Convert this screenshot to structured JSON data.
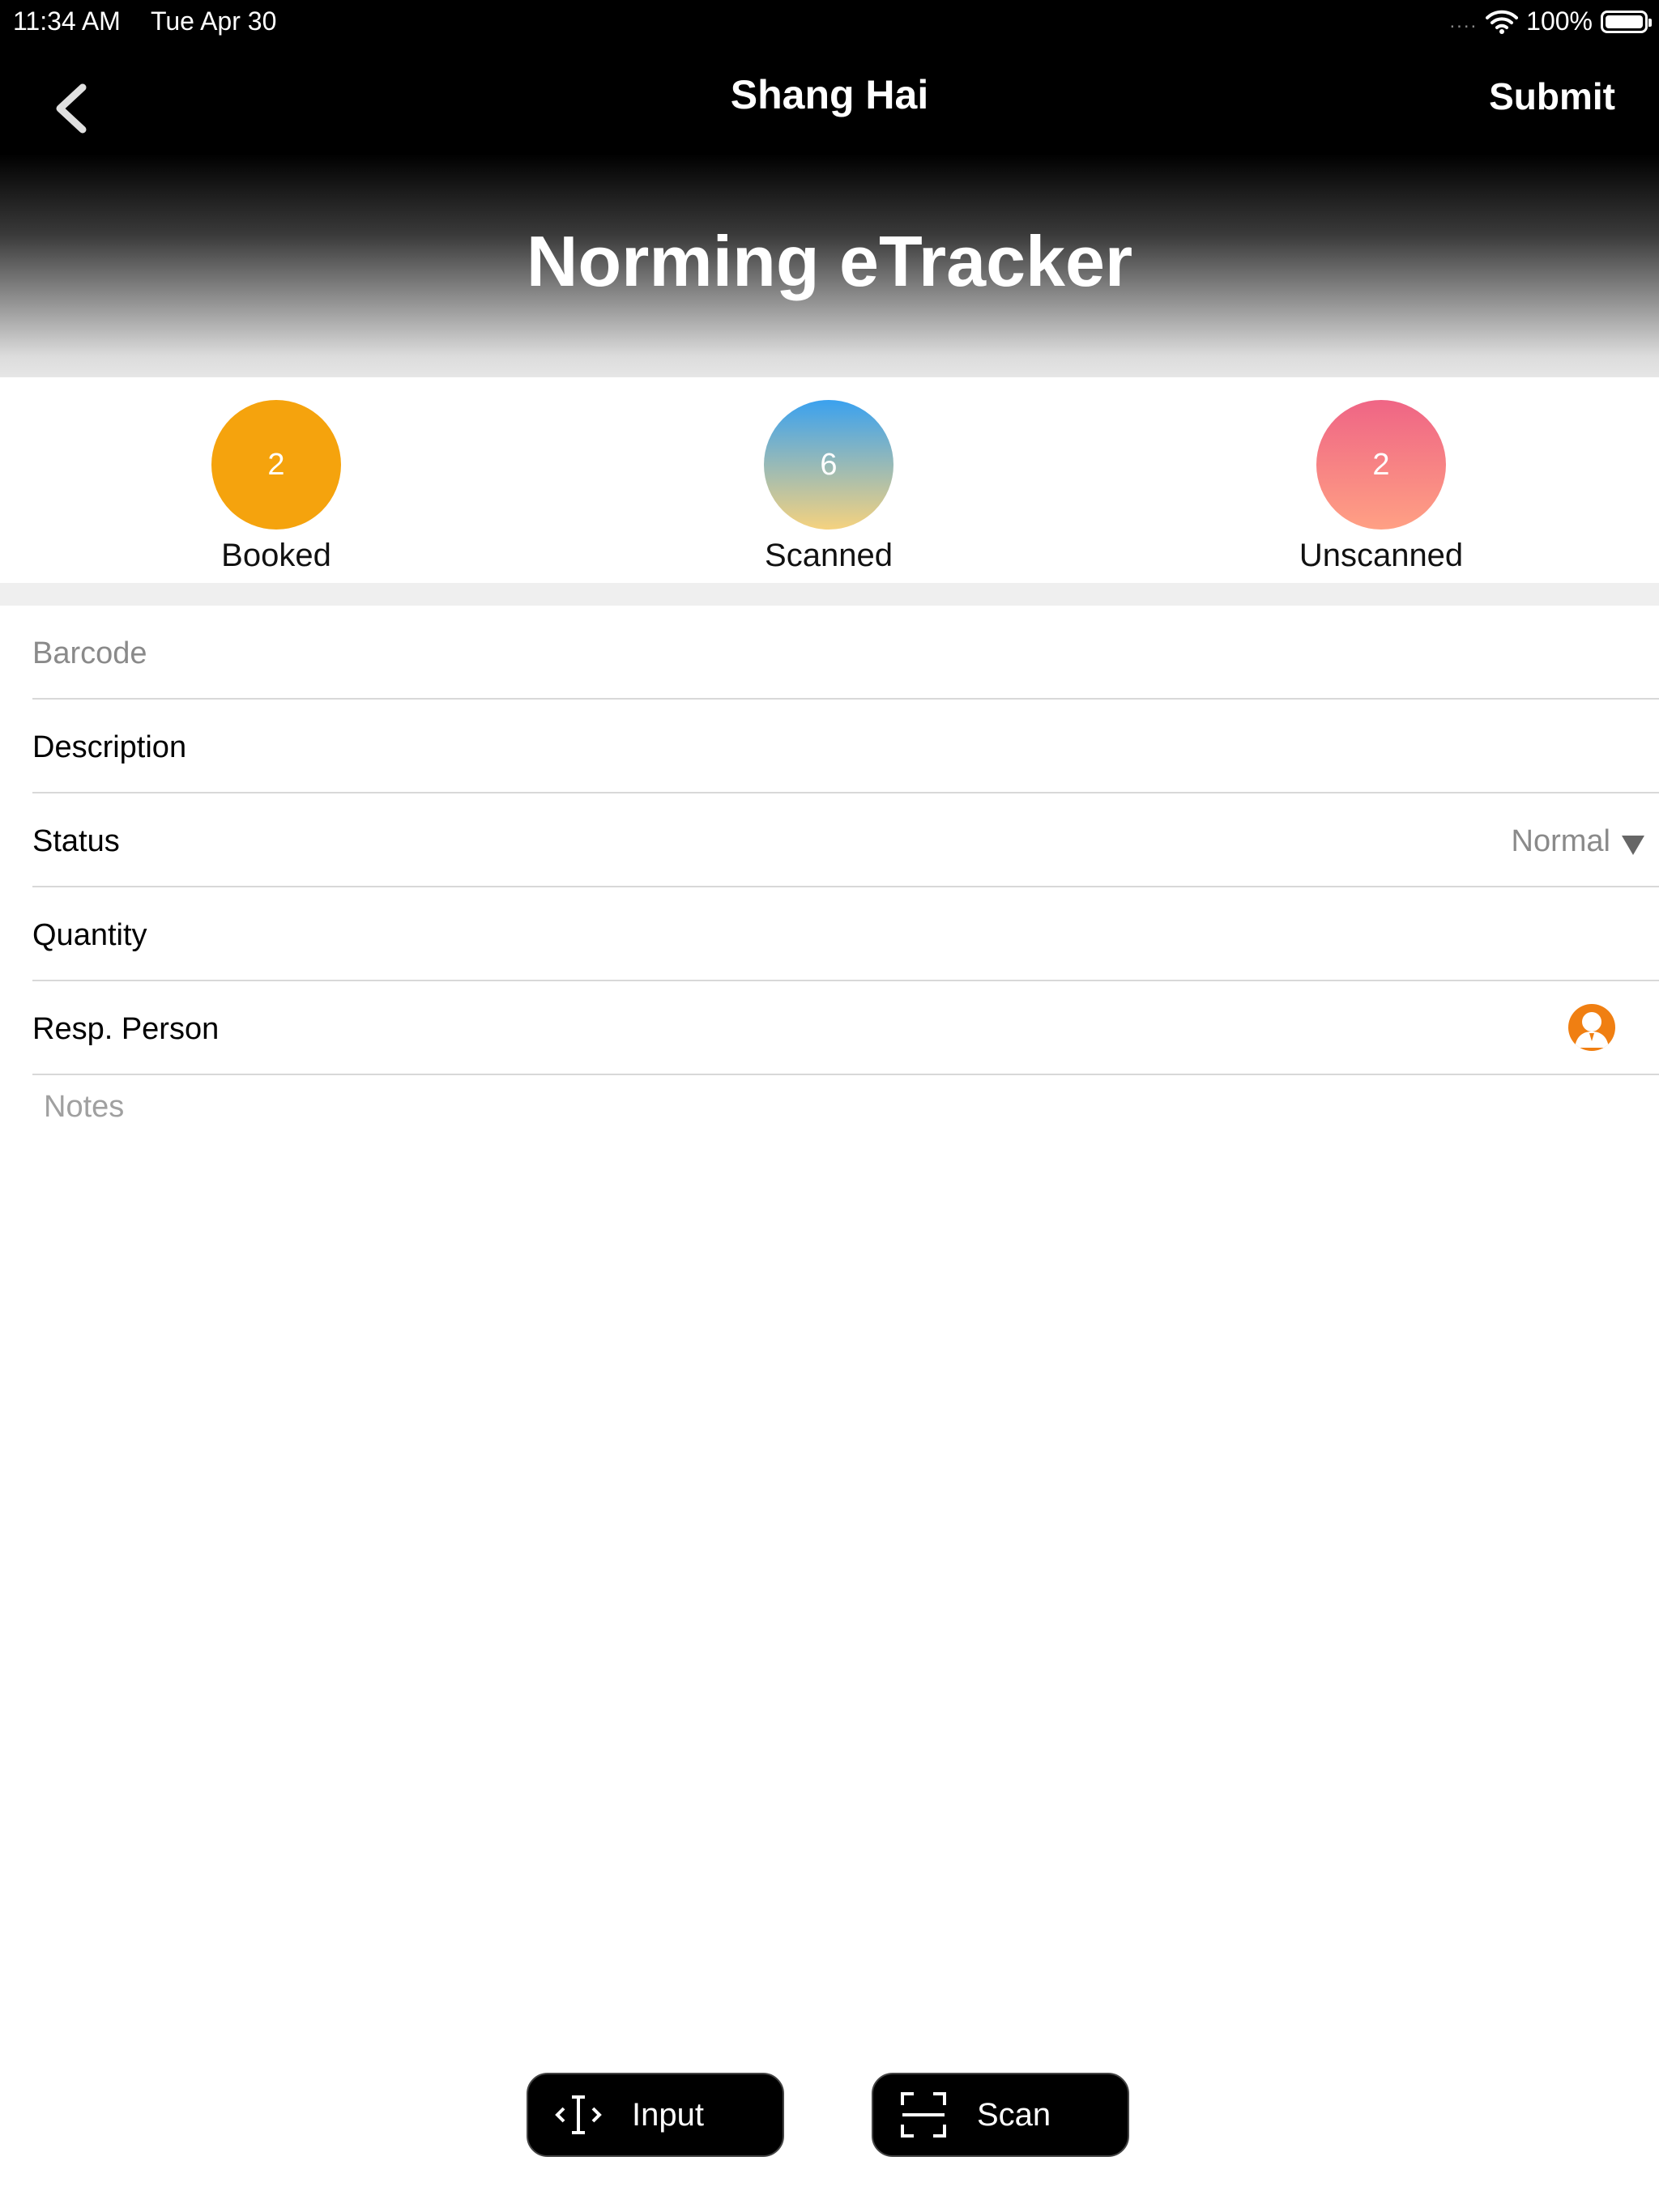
{
  "status_bar": {
    "time": "11:34 AM",
    "date": "Tue Apr 30",
    "signal": "....",
    "battery": "100%"
  },
  "nav": {
    "title": "Shang Hai",
    "submit_label": "Submit",
    "back_icon": "chevron-left-icon"
  },
  "app_title": "Norming eTracker",
  "stats": [
    {
      "count": "2",
      "label": "Booked",
      "color": "#f5a30d"
    },
    {
      "count": "6",
      "label": "Scanned",
      "color": "#3aa1ef"
    },
    {
      "count": "2",
      "label": "Unscanned",
      "color": "#ef6585"
    }
  ],
  "form": {
    "barcode_placeholder": "Barcode",
    "description_label": "Description",
    "status_label": "Status",
    "status_value": "Normal",
    "quantity_label": "Quantity",
    "resp_person_label": "Resp. Person",
    "notes_placeholder": "Notes"
  },
  "buttons": {
    "input_label": "Input",
    "scan_label": "Scan"
  },
  "colors": {
    "accent_orange": "#f07f12"
  }
}
